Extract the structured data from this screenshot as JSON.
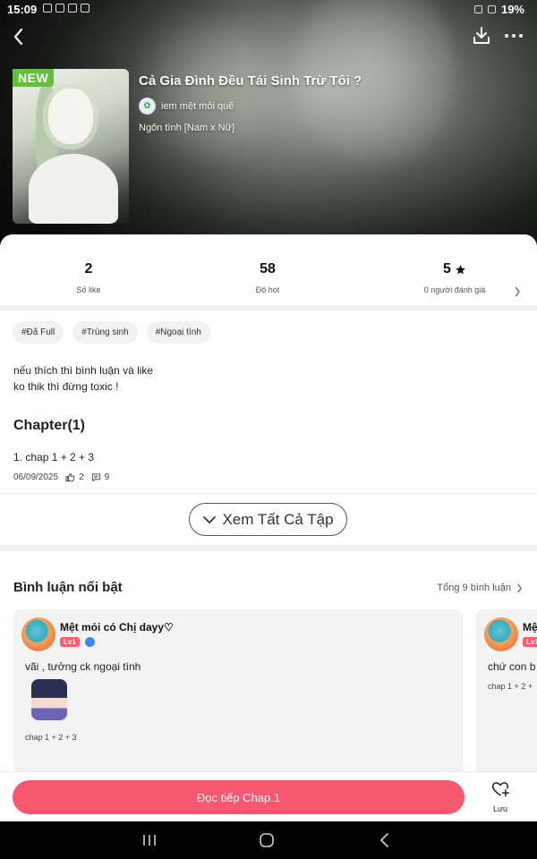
{
  "status_bar": {
    "time": "15:09",
    "battery": "19%"
  },
  "story": {
    "badge": "NEW",
    "title": "Cả Gia Đình Đều Tái Sinh Trừ Tôi ?",
    "author": "iem mệt mỏi quế",
    "genre": "Ngôn tình [Nam x Nữ]"
  },
  "stats": [
    {
      "value": "2",
      "label": "Số like"
    },
    {
      "value": "58",
      "label": "Độ hot"
    },
    {
      "value": "5",
      "label": "0 người đánh giá"
    }
  ],
  "tags": [
    "#Đã Full",
    "#Trùng sinh",
    "#Ngoại tình"
  ],
  "description": [
    "nếu thích thì bình luận và like",
    "ko thik thì đừng toxic !"
  ],
  "chapters": {
    "heading": "Chapter(1)",
    "items": [
      {
        "title": "1. chap 1 + 2 + 3",
        "date": "06/09/2025",
        "likes": "2",
        "comments": "9"
      }
    ],
    "see_all": "Xem Tất Cả Tập"
  },
  "comments": {
    "heading": "Bình luận nổi bật",
    "total": "Tổng 9 bình luận",
    "items": [
      {
        "name": "Mệt mỏi có Chị dayy♡",
        "level": "Lv1",
        "text": "vãi , tưởng ck ngoại tình",
        "chapter": "chap 1 + 2 + 3"
      },
      {
        "name": "Mệ",
        "level": "Lv1",
        "text": "chứ con b",
        "chapter": "chap 1 + 2 +"
      }
    ]
  },
  "actions": {
    "read": "Đọc tiếp Chap.1",
    "save": "Lưu"
  },
  "colors": {
    "accent": "#f5586f",
    "new_badge": "#61c23a",
    "level_badge": "#ff5b6e"
  }
}
